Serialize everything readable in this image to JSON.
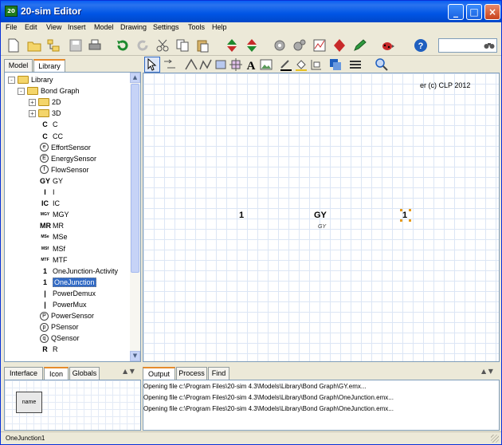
{
  "window": {
    "title": "20-sim Editor",
    "app_icon_text": "20"
  },
  "menu": [
    "File",
    "Edit",
    "View",
    "Insert",
    "Model",
    "Drawing",
    "Settings",
    "Tools",
    "Help"
  ],
  "left_tabs": [
    "Model",
    "Library"
  ],
  "left_active_tab": "Library",
  "tree": [
    {
      "label": "Library",
      "type": "folder",
      "expand": "-",
      "level": 0
    },
    {
      "label": "Bond Graph",
      "type": "folder",
      "expand": "-",
      "level": 1
    },
    {
      "label": "2D",
      "type": "folder",
      "expand": "+",
      "level": 2
    },
    {
      "label": "3D",
      "type": "folder",
      "expand": "+",
      "level": 2
    },
    {
      "label": "C",
      "glyph": "C",
      "level": 3
    },
    {
      "label": "CC",
      "glyph": "C",
      "level": 3
    },
    {
      "label": "EffortSensor",
      "glyph": "e",
      "circle": true,
      "level": 3
    },
    {
      "label": "EnergySensor",
      "glyph": "E",
      "circle": true,
      "level": 3
    },
    {
      "label": "FlowSensor",
      "glyph": "f",
      "circle": true,
      "level": 3
    },
    {
      "label": "GY",
      "glyph": "GY",
      "level": 3
    },
    {
      "label": "I",
      "glyph": "I",
      "level": 3
    },
    {
      "label": "IC",
      "glyph": "IC",
      "level": 3
    },
    {
      "label": "MGY",
      "glyph": "MGY",
      "small": true,
      "level": 3
    },
    {
      "label": "MR",
      "glyph": "MR",
      "level": 3
    },
    {
      "label": "MSe",
      "glyph": "MSe",
      "small": true,
      "level": 3
    },
    {
      "label": "MSf",
      "glyph": "MSf",
      "small": true,
      "level": 3
    },
    {
      "label": "MTF",
      "glyph": "MTF",
      "small": true,
      "level": 3
    },
    {
      "label": "OneJunction-Activity",
      "glyph": "1",
      "level": 3
    },
    {
      "label": "OneJunction",
      "glyph": "1",
      "level": 3,
      "selected": true
    },
    {
      "label": "PowerDemux",
      "glyph": "|",
      "level": 3
    },
    {
      "label": "PowerMux",
      "glyph": "|",
      "level": 3
    },
    {
      "label": "PowerSensor",
      "glyph": "P",
      "circle": true,
      "level": 3
    },
    {
      "label": "PSensor",
      "glyph": "p",
      "circle": true,
      "level": 3
    },
    {
      "label": "QSensor",
      "glyph": "q",
      "circle": true,
      "level": 3
    },
    {
      "label": "R",
      "glyph": "R",
      "level": 3
    }
  ],
  "canvas": {
    "copyright": "er (c) CLP 2012",
    "nodes": [
      {
        "label": "1",
        "name": "node-onejunction-left"
      },
      {
        "label": "GY",
        "sublabel": "GY",
        "name": "node-gy"
      },
      {
        "label": "1",
        "name": "node-onejunction-selected",
        "selected": true
      }
    ]
  },
  "bottom_left_tabs": [
    "Interface",
    "Icon",
    "Globals"
  ],
  "bottom_left_active": "Icon",
  "icon_preview_label": "name",
  "bottom_right_tabs": [
    "Output",
    "Process",
    "Find"
  ],
  "bottom_right_active": "Output",
  "output_lines": [
    "Opening file c:\\Program Files\\20-sim 4.3\\Models\\Library\\Bond Graph\\GY.emx...",
    "Opening file c:\\Program Files\\20-sim 4.3\\Models\\Library\\Bond Graph\\OneJunction.emx...",
    "Opening file c:\\Program Files\\20-sim 4.3\\Models\\Library\\Bond Graph\\OneJunction.emx..."
  ],
  "status": "OneJunction1",
  "icons": {
    "toolbar": [
      "new-file-icon",
      "open-file-icon",
      "model-tree-icon",
      "save-icon",
      "print-icon",
      "undo-icon",
      "redo-icon",
      "cut-icon",
      "copy-icon",
      "paste-icon",
      "go-up-icon",
      "go-down-icon",
      "check-icon",
      "compile-icon",
      "simulator-icon",
      "diamond-icon",
      "pen-icon",
      "bug-icon",
      "help-icon"
    ],
    "canvas_toolbar": [
      "select-icon",
      "connect-icon",
      "line-icon",
      "polyline-icon",
      "rectangle-icon",
      "crosshair-icon",
      "text-icon",
      "image-icon",
      "line-color-icon",
      "fill-color-icon",
      "shape-icon",
      "object-color-icon",
      "line-style-icon",
      "zoom-icon"
    ]
  },
  "colors": {
    "selection": "#316ac5",
    "titlebar": "#0055e5",
    "handle": "#e69a1a"
  }
}
